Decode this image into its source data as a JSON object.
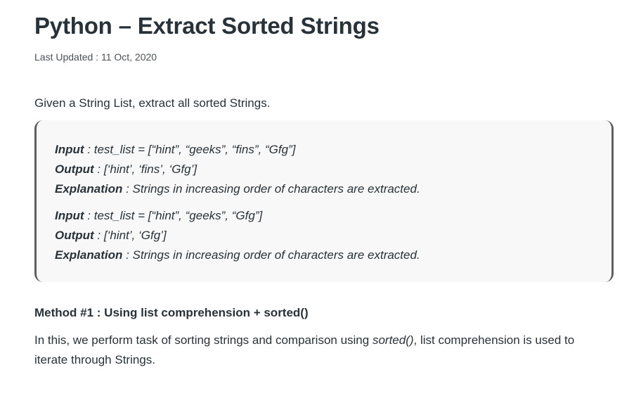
{
  "article": {
    "title": "Python – Extract Sorted Strings",
    "last_updated_label": "Last Updated : ",
    "last_updated_value": "11 Oct, 2020",
    "intro": "Given a String List, extract all sorted Strings.",
    "examples": [
      {
        "input_key": "Input",
        "input_value": " : test_list = [“hint”, “geeks”, “fins”, “Gfg”]",
        "output_key": "Output",
        "output_value": " : [‘hint’, ‘fins’, ‘Gfg’]",
        "explanation_key": "Explanation",
        "explanation_value": " : Strings in increasing order of characters are extracted."
      },
      {
        "input_key": "Input",
        "input_value": " : test_list = [“hint”, “geeks”, “Gfg”]",
        "output_key": "Output",
        "output_value": " : [‘hint’, ‘Gfg’]",
        "explanation_key": "Explanation",
        "explanation_value": " : Strings in increasing order of characters are extracted."
      }
    ],
    "method_heading": "Method #1 : Using list comprehension + sorted()",
    "description_before": "In this, we perform task of sorting strings and comparison using ",
    "description_code": "sorted()",
    "description_after": ", list comprehension is used to iterate through Strings."
  }
}
